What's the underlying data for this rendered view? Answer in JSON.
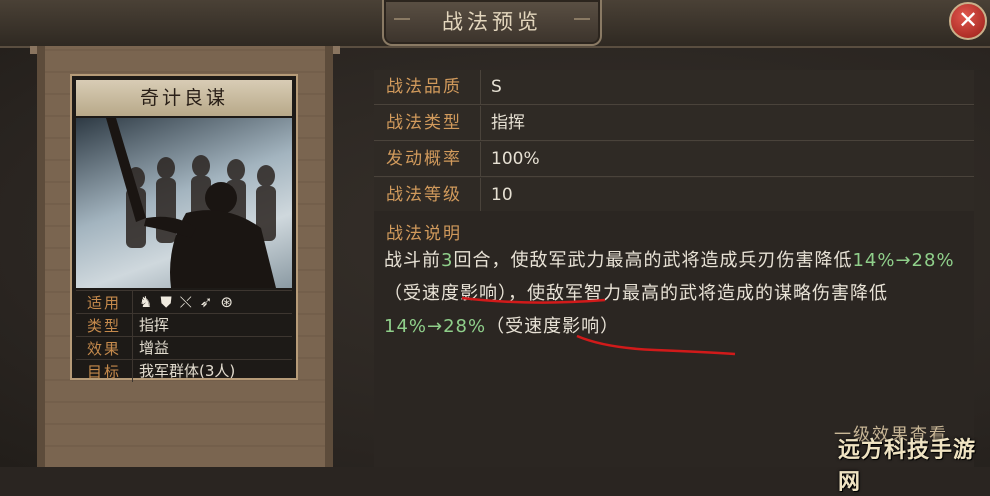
{
  "header": {
    "title": "战法预览",
    "close_label": "✕"
  },
  "card": {
    "name": "奇计良谋",
    "rows": [
      {
        "key": "适用",
        "icons": [
          "cavalry-icon",
          "shield-icon",
          "bow-icon",
          "spear-icon",
          "wheel-icon"
        ]
      },
      {
        "key": "类型",
        "value": "指挥"
      },
      {
        "key": "效果",
        "value": "增益"
      },
      {
        "key": "目标",
        "value": "我军群体(3人)"
      }
    ]
  },
  "info": {
    "rows": [
      {
        "key": "战法品质",
        "value": "S"
      },
      {
        "key": "战法类型",
        "value": "指挥"
      },
      {
        "key": "发动概率",
        "value": "100%"
      },
      {
        "key": "战法等级",
        "value": "10"
      }
    ],
    "desc_label": "战法说明",
    "desc_parts": [
      {
        "t": "战斗前",
        "c": "w"
      },
      {
        "t": "3",
        "c": "g"
      },
      {
        "t": "回合，使敌军武力最高的武将造成兵刃伤害降低",
        "c": "w"
      },
      {
        "t": "14%→28%",
        "c": "g"
      },
      {
        "t": "（受速度影响），使敌军智力最高的武将造成的谋略伤害降低",
        "c": "w"
      },
      {
        "t": "14%→28%",
        "c": "g"
      },
      {
        "t": "（受速度影响）",
        "c": "w"
      }
    ]
  },
  "footer": {
    "view_more": "一级效果查看",
    "watermark": "远方科技手游网"
  },
  "colors": {
    "accent_label": "#d19a5c",
    "highlight_green": "#8fcf8a",
    "close_red": "#c0302a"
  }
}
